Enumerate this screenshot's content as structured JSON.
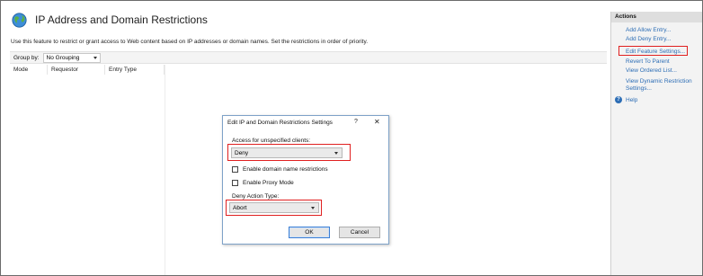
{
  "page": {
    "title": "IP Address and Domain Restrictions",
    "description": "Use this feature to restrict or grant access to Web content based on IP addresses or domain names. Set the restrictions in order of priority."
  },
  "groupby": {
    "label": "Group by:",
    "value": "No Grouping"
  },
  "list": {
    "columns": [
      "Mode",
      "Requestor",
      "Entry Type"
    ]
  },
  "actions": {
    "title": "Actions",
    "items": [
      "Add Allow Entry...",
      "Add Deny Entry...",
      "Edit Feature Settings...",
      "Revert To Parent",
      "View Ordered List...",
      "View Dynamic Restriction",
      "Settings..."
    ],
    "help": "Help"
  },
  "dialog": {
    "title": "Edit IP and Domain Restrictions Settings",
    "help_glyph": "?",
    "close_glyph": "✕",
    "access_label": "Access for unspecified clients:",
    "access_value": "Deny",
    "enable_domain": "Enable domain name restrictions",
    "enable_proxy": "Enable Proxy Mode",
    "deny_action_label": "Deny Action Type:",
    "deny_action_value": "Abort",
    "ok": "OK",
    "cancel": "Cancel"
  },
  "colors": {
    "link": "#2c6db5",
    "highlight": "#e02020"
  }
}
